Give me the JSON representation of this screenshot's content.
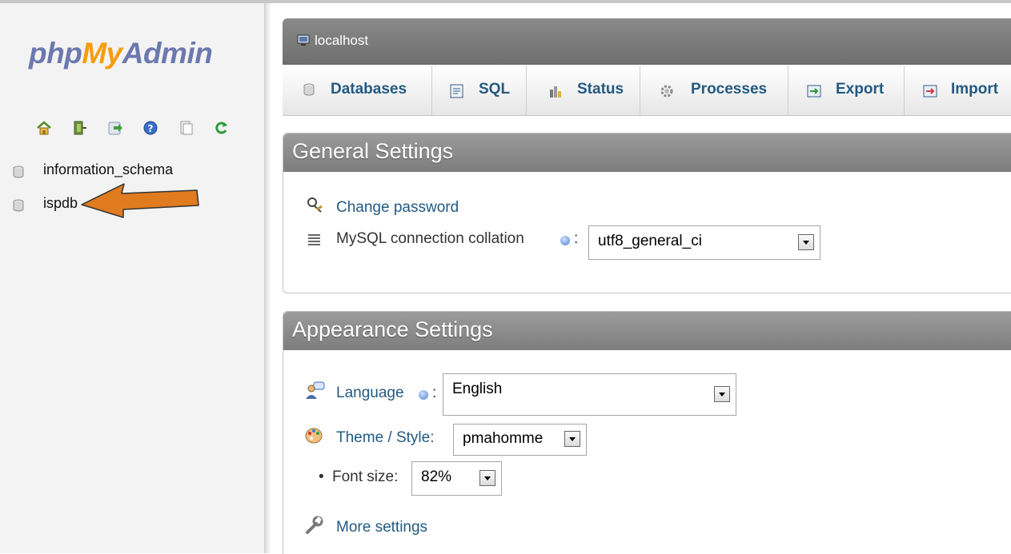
{
  "app": {
    "logo": {
      "part1": "php",
      "part2": "My",
      "part3": "Admin"
    },
    "accent_color": "#f89c0e",
    "brand_color": "#6c78af",
    "link_color": "#235a81"
  },
  "nav": {
    "icons": [
      "home-icon",
      "logout-icon",
      "query-window-icon",
      "help-icon",
      "documentation-icon",
      "reload-icon"
    ],
    "databases": [
      {
        "name": "information_schema"
      },
      {
        "name": "ispdb"
      }
    ],
    "annotation_color": "#e07b1f"
  },
  "server": {
    "label": "localhost"
  },
  "tabs": [
    {
      "label": "Databases",
      "icon": "database-icon"
    },
    {
      "label": "SQL",
      "icon": "sql-icon"
    },
    {
      "label": "Status",
      "icon": "status-chart-icon"
    },
    {
      "label": "Processes",
      "icon": "gear-icon"
    },
    {
      "label": "Export",
      "icon": "export-icon"
    },
    {
      "label": "Import",
      "icon": "import-icon"
    }
  ],
  "general": {
    "title": "General Settings",
    "change_password": "Change password",
    "collation_label": "MySQL connection collation",
    "collation_sep": ":",
    "collation_value": "utf8_general_ci"
  },
  "appearance": {
    "title": "Appearance Settings",
    "language_label": "Language",
    "language_sep": ":",
    "language_value": "English",
    "theme_label": "Theme / Style:",
    "theme_value": "pmahomme",
    "fontsize_bullet": "•",
    "fontsize_label": "Font size:",
    "fontsize_value": "82%",
    "more_settings": "More settings"
  }
}
